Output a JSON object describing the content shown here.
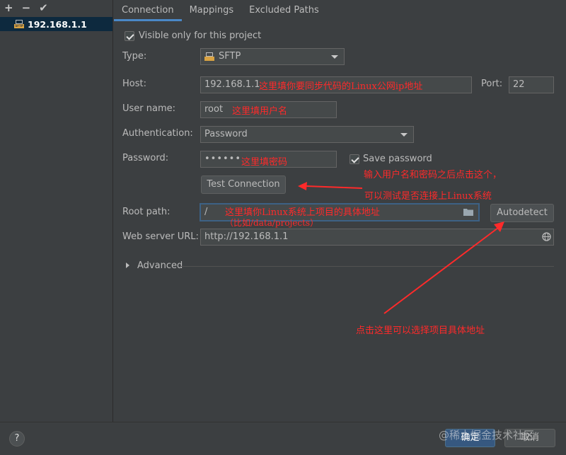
{
  "toolbar": {
    "add": "+",
    "remove": "−",
    "apply": "✔"
  },
  "servers": [
    {
      "label": "192.168.1.1",
      "icon_text": "SFTP"
    }
  ],
  "tabs": [
    {
      "label": "Connection"
    },
    {
      "label": "Mappings"
    },
    {
      "label": "Excluded Paths"
    }
  ],
  "form": {
    "visible_only_label": "Visible only for this project",
    "type_label": "Type:",
    "type_value": "SFTP",
    "host_label": "Host:",
    "host_value": "192.168.1.1",
    "port_label": "Port:",
    "port_value": "22",
    "username_label": "User name:",
    "username_value": "root",
    "auth_label": "Authentication:",
    "auth_value": "Password",
    "password_label": "Password:",
    "password_value": "••••••",
    "save_password_label": "Save password",
    "test_connection_label": "Test Connection",
    "root_path_label": "Root path:",
    "root_path_value": "/",
    "autodetect_label": "Autodetect",
    "web_url_label": "Web server URL:",
    "web_url_value": "http://192.168.1.1",
    "advanced_label": "Advanced"
  },
  "annotations": {
    "host": "这里填你要同步代码的Linux公网ip地址",
    "username": "这里填用户名",
    "password": "这里填密码",
    "test_line1": "输入用户名和密码之后点击这个，",
    "test_line2": "可以测试是否连接上Linux系统",
    "root_line1": "这里填你Linux系统上项目的具体地址",
    "root_line2": "（比如/data/projects）",
    "autodetect": "点击这里可以选择项目具体地址"
  },
  "footer": {
    "help": "?",
    "ok_label": "确定",
    "cancel_label": "取消",
    "watermark": "@稀土掘金技术社区"
  },
  "colors": {
    "background": "#3c3f41",
    "accent": "#4a88c7",
    "annotation": "#ff2a2a"
  }
}
